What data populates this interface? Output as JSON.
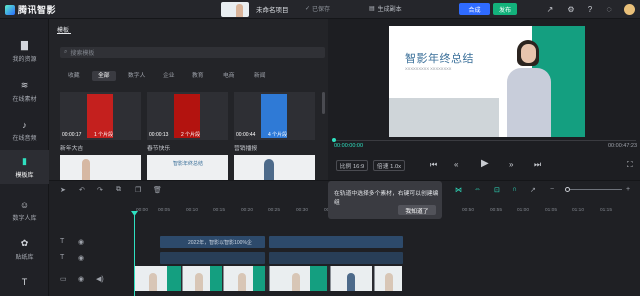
{
  "brand": {
    "name": "腾讯智影"
  },
  "project": {
    "name": "未命名项目",
    "saved": "已保存",
    "generate_draft": "生成副本"
  },
  "topbar": {
    "compose": "合成",
    "publish": "发布"
  },
  "nav": [
    {
      "label": "我的资源",
      "icon": "folder-icon"
    },
    {
      "label": "在线素材",
      "icon": "layers-icon"
    },
    {
      "label": "在线音频",
      "icon": "music-icon"
    },
    {
      "label": "模板库",
      "icon": "template-icon",
      "active": true
    },
    {
      "label": "数字人库",
      "icon": "avatar-icon"
    },
    {
      "label": "贴纸库",
      "icon": "sticker-icon"
    },
    {
      "label": "",
      "icon": "text-icon"
    }
  ],
  "panel": {
    "tab": "模板",
    "search_placeholder": "搜索模板",
    "categories": [
      "收藏",
      "全部",
      "数字人",
      "企业",
      "教育",
      "电商",
      "新闻"
    ],
    "active_category": "全部",
    "cards": [
      {
        "duration": "00:00:17",
        "count": "1 个片段",
        "label": "新年大吉"
      },
      {
        "duration": "00:00:13",
        "count": "2 个片段",
        "label": "春节快乐"
      },
      {
        "duration": "00:00:44",
        "count": "4 个片段",
        "label": "营销播报"
      }
    ],
    "card2_title": "智影年终总结"
  },
  "preview": {
    "title": "智影年终总结",
    "subtitle": "XXXXXXXXX XXXXXXXX",
    "current_time": "00:00:00:00",
    "total_time": "00:00:47:23",
    "ratio": "比例 16:9",
    "speed": "倍速 1.0x"
  },
  "timeline": {
    "ticks": [
      "00:00",
      "00:05",
      "00:10",
      "00:15",
      "00:20",
      "00:25",
      "00:30",
      "00:35",
      "00:40",
      "00:45",
      "00:50",
      "00:55",
      "01:00",
      "01:05",
      "01:10",
      "01:15"
    ],
    "text_clip": "2022年，智影以智影100%企",
    "toast": "在轨道中选择多个素材，右键可以创建编组",
    "toast_button": "我知道了"
  },
  "colors": {
    "accent": "#2fe0c0",
    "compose": "#2f6bff",
    "publish": "#13b27b"
  }
}
